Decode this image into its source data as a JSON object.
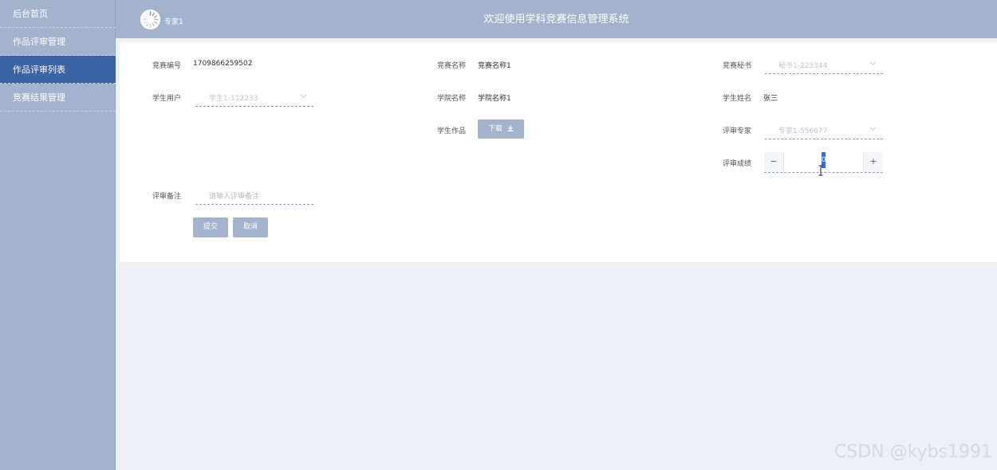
{
  "sidebar": {
    "items": [
      {
        "label": "后台首页",
        "active": false
      },
      {
        "label": "作品评审管理",
        "active": false
      },
      {
        "label": "作品评审列表",
        "active": true
      },
      {
        "label": "竞赛结果管理",
        "active": false
      }
    ]
  },
  "header": {
    "user_name": "专家1",
    "title": "欢迎使用学科竞赛信息管理系统"
  },
  "form": {
    "competition_no": {
      "label": "竞赛编号",
      "value": "1709866259502"
    },
    "competition_name": {
      "label": "竞赛名称",
      "value": "竞赛名称1"
    },
    "secretary": {
      "label": "竞赛秘书",
      "placeholder": "秘书1-223344"
    },
    "student_user": {
      "label": "学生用户",
      "placeholder": "学生1-112233"
    },
    "college_name": {
      "label": "学院名称",
      "value": "学院名称1"
    },
    "student_name": {
      "label": "学生姓名",
      "value": "张三"
    },
    "student_work": {
      "label": "学生作品",
      "download_label": "下载"
    },
    "expert": {
      "label": "评审专家",
      "placeholder": "专家1-556677"
    },
    "score": {
      "label": "评审成绩",
      "value": "0"
    },
    "remark": {
      "label": "评审备注",
      "placeholder": "请输入评审备注"
    },
    "submit_label": "提交",
    "cancel_label": "取消"
  },
  "icons": {
    "chevron": "chevron-down-icon",
    "download": "download-icon",
    "avatar": "avatar-icon"
  },
  "colors": {
    "sidebar": "#a3b2cd",
    "active": "#3b63a5",
    "button": "#a3b2cd"
  },
  "watermark": "CSDN @kybs1991"
}
